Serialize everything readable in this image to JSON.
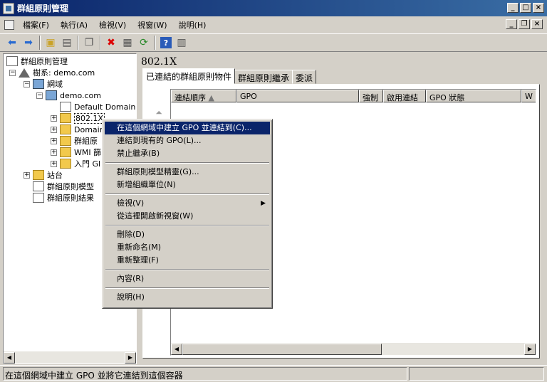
{
  "window": {
    "title": "群組原則管理"
  },
  "menubar": {
    "items": [
      "檔案(F)",
      "執行(A)",
      "檢視(V)",
      "視窗(W)",
      "說明(H)"
    ]
  },
  "toolbar": {
    "icons": [
      "back-arrow-icon",
      "forward-arrow-icon",
      "up-folder-icon",
      "console-tree-icon",
      "copy-icon",
      "delete-icon",
      "properties-icon",
      "refresh-icon",
      "help-icon",
      "view-icon"
    ]
  },
  "tree": {
    "root": "群組原則管理",
    "forest": "樹系: demo.com",
    "domains": "網域",
    "domain": "demo.com",
    "default_policy": "Default Domain P",
    "ou_8021x": "802.1X",
    "domain_controllers": "Domain",
    "gpo_objects": "群組原",
    "wmi": "WMI 篩",
    "starter": "入門 Gl",
    "sites": "站台",
    "modeling": "群組原則模型",
    "results": "群組原則結果"
  },
  "right": {
    "title": "802.1X",
    "tabs": [
      "已連結的群組原則物件",
      "群組原則繼承",
      "委派"
    ],
    "columns": [
      "連結順序",
      "GPO",
      "強制",
      "啟用連結",
      "GPO 狀態",
      "W"
    ]
  },
  "context_menu": {
    "items": [
      "在這個網域中建立 GPO 並連結到(C)...",
      "連結到現有的 GPO(L)...",
      "禁止繼承(B)",
      "群組原則模型精靈(G)...",
      "新增組織單位(N)",
      "檢視(V)",
      "從這裡開啟新視窗(W)",
      "刪除(D)",
      "重新命名(M)",
      "重新整理(F)",
      "內容(R)",
      "說明(H)"
    ]
  },
  "status": {
    "text": "在這個網域中建立 GPO 並將它連結到這個容器"
  }
}
